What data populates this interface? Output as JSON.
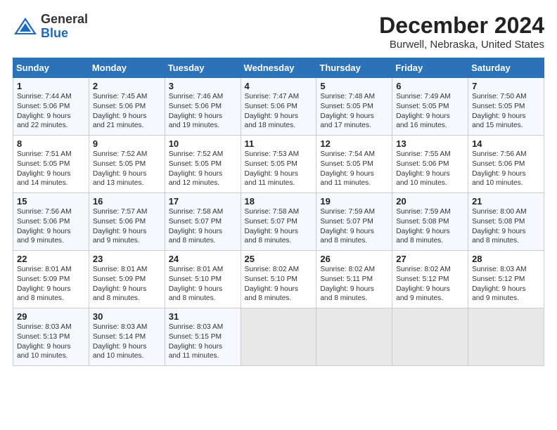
{
  "logo": {
    "general": "General",
    "blue": "Blue"
  },
  "title": "December 2024",
  "subtitle": "Burwell, Nebraska, United States",
  "days_header": [
    "Sunday",
    "Monday",
    "Tuesday",
    "Wednesday",
    "Thursday",
    "Friday",
    "Saturday"
  ],
  "weeks": [
    [
      {
        "num": "1",
        "info": "Sunrise: 7:44 AM\nSunset: 5:06 PM\nDaylight: 9 hours\nand 22 minutes."
      },
      {
        "num": "2",
        "info": "Sunrise: 7:45 AM\nSunset: 5:06 PM\nDaylight: 9 hours\nand 21 minutes."
      },
      {
        "num": "3",
        "info": "Sunrise: 7:46 AM\nSunset: 5:06 PM\nDaylight: 9 hours\nand 19 minutes."
      },
      {
        "num": "4",
        "info": "Sunrise: 7:47 AM\nSunset: 5:06 PM\nDaylight: 9 hours\nand 18 minutes."
      },
      {
        "num": "5",
        "info": "Sunrise: 7:48 AM\nSunset: 5:05 PM\nDaylight: 9 hours\nand 17 minutes."
      },
      {
        "num": "6",
        "info": "Sunrise: 7:49 AM\nSunset: 5:05 PM\nDaylight: 9 hours\nand 16 minutes."
      },
      {
        "num": "7",
        "info": "Sunrise: 7:50 AM\nSunset: 5:05 PM\nDaylight: 9 hours\nand 15 minutes."
      }
    ],
    [
      {
        "num": "8",
        "info": "Sunrise: 7:51 AM\nSunset: 5:05 PM\nDaylight: 9 hours\nand 14 minutes."
      },
      {
        "num": "9",
        "info": "Sunrise: 7:52 AM\nSunset: 5:05 PM\nDaylight: 9 hours\nand 13 minutes."
      },
      {
        "num": "10",
        "info": "Sunrise: 7:52 AM\nSunset: 5:05 PM\nDaylight: 9 hours\nand 12 minutes."
      },
      {
        "num": "11",
        "info": "Sunrise: 7:53 AM\nSunset: 5:05 PM\nDaylight: 9 hours\nand 11 minutes."
      },
      {
        "num": "12",
        "info": "Sunrise: 7:54 AM\nSunset: 5:05 PM\nDaylight: 9 hours\nand 11 minutes."
      },
      {
        "num": "13",
        "info": "Sunrise: 7:55 AM\nSunset: 5:06 PM\nDaylight: 9 hours\nand 10 minutes."
      },
      {
        "num": "14",
        "info": "Sunrise: 7:56 AM\nSunset: 5:06 PM\nDaylight: 9 hours\nand 10 minutes."
      }
    ],
    [
      {
        "num": "15",
        "info": "Sunrise: 7:56 AM\nSunset: 5:06 PM\nDaylight: 9 hours\nand 9 minutes."
      },
      {
        "num": "16",
        "info": "Sunrise: 7:57 AM\nSunset: 5:06 PM\nDaylight: 9 hours\nand 9 minutes."
      },
      {
        "num": "17",
        "info": "Sunrise: 7:58 AM\nSunset: 5:07 PM\nDaylight: 9 hours\nand 8 minutes."
      },
      {
        "num": "18",
        "info": "Sunrise: 7:58 AM\nSunset: 5:07 PM\nDaylight: 9 hours\nand 8 minutes."
      },
      {
        "num": "19",
        "info": "Sunrise: 7:59 AM\nSunset: 5:07 PM\nDaylight: 9 hours\nand 8 minutes."
      },
      {
        "num": "20",
        "info": "Sunrise: 7:59 AM\nSunset: 5:08 PM\nDaylight: 9 hours\nand 8 minutes."
      },
      {
        "num": "21",
        "info": "Sunrise: 8:00 AM\nSunset: 5:08 PM\nDaylight: 9 hours\nand 8 minutes."
      }
    ],
    [
      {
        "num": "22",
        "info": "Sunrise: 8:01 AM\nSunset: 5:09 PM\nDaylight: 9 hours\nand 8 minutes."
      },
      {
        "num": "23",
        "info": "Sunrise: 8:01 AM\nSunset: 5:09 PM\nDaylight: 9 hours\nand 8 minutes."
      },
      {
        "num": "24",
        "info": "Sunrise: 8:01 AM\nSunset: 5:10 PM\nDaylight: 9 hours\nand 8 minutes."
      },
      {
        "num": "25",
        "info": "Sunrise: 8:02 AM\nSunset: 5:10 PM\nDaylight: 9 hours\nand 8 minutes."
      },
      {
        "num": "26",
        "info": "Sunrise: 8:02 AM\nSunset: 5:11 PM\nDaylight: 9 hours\nand 8 minutes."
      },
      {
        "num": "27",
        "info": "Sunrise: 8:02 AM\nSunset: 5:12 PM\nDaylight: 9 hours\nand 9 minutes."
      },
      {
        "num": "28",
        "info": "Sunrise: 8:03 AM\nSunset: 5:12 PM\nDaylight: 9 hours\nand 9 minutes."
      }
    ],
    [
      {
        "num": "29",
        "info": "Sunrise: 8:03 AM\nSunset: 5:13 PM\nDaylight: 9 hours\nand 10 minutes."
      },
      {
        "num": "30",
        "info": "Sunrise: 8:03 AM\nSunset: 5:14 PM\nDaylight: 9 hours\nand 10 minutes."
      },
      {
        "num": "31",
        "info": "Sunrise: 8:03 AM\nSunset: 5:15 PM\nDaylight: 9 hours\nand 11 minutes."
      },
      {
        "num": "",
        "info": ""
      },
      {
        "num": "",
        "info": ""
      },
      {
        "num": "",
        "info": ""
      },
      {
        "num": "",
        "info": ""
      }
    ]
  ]
}
